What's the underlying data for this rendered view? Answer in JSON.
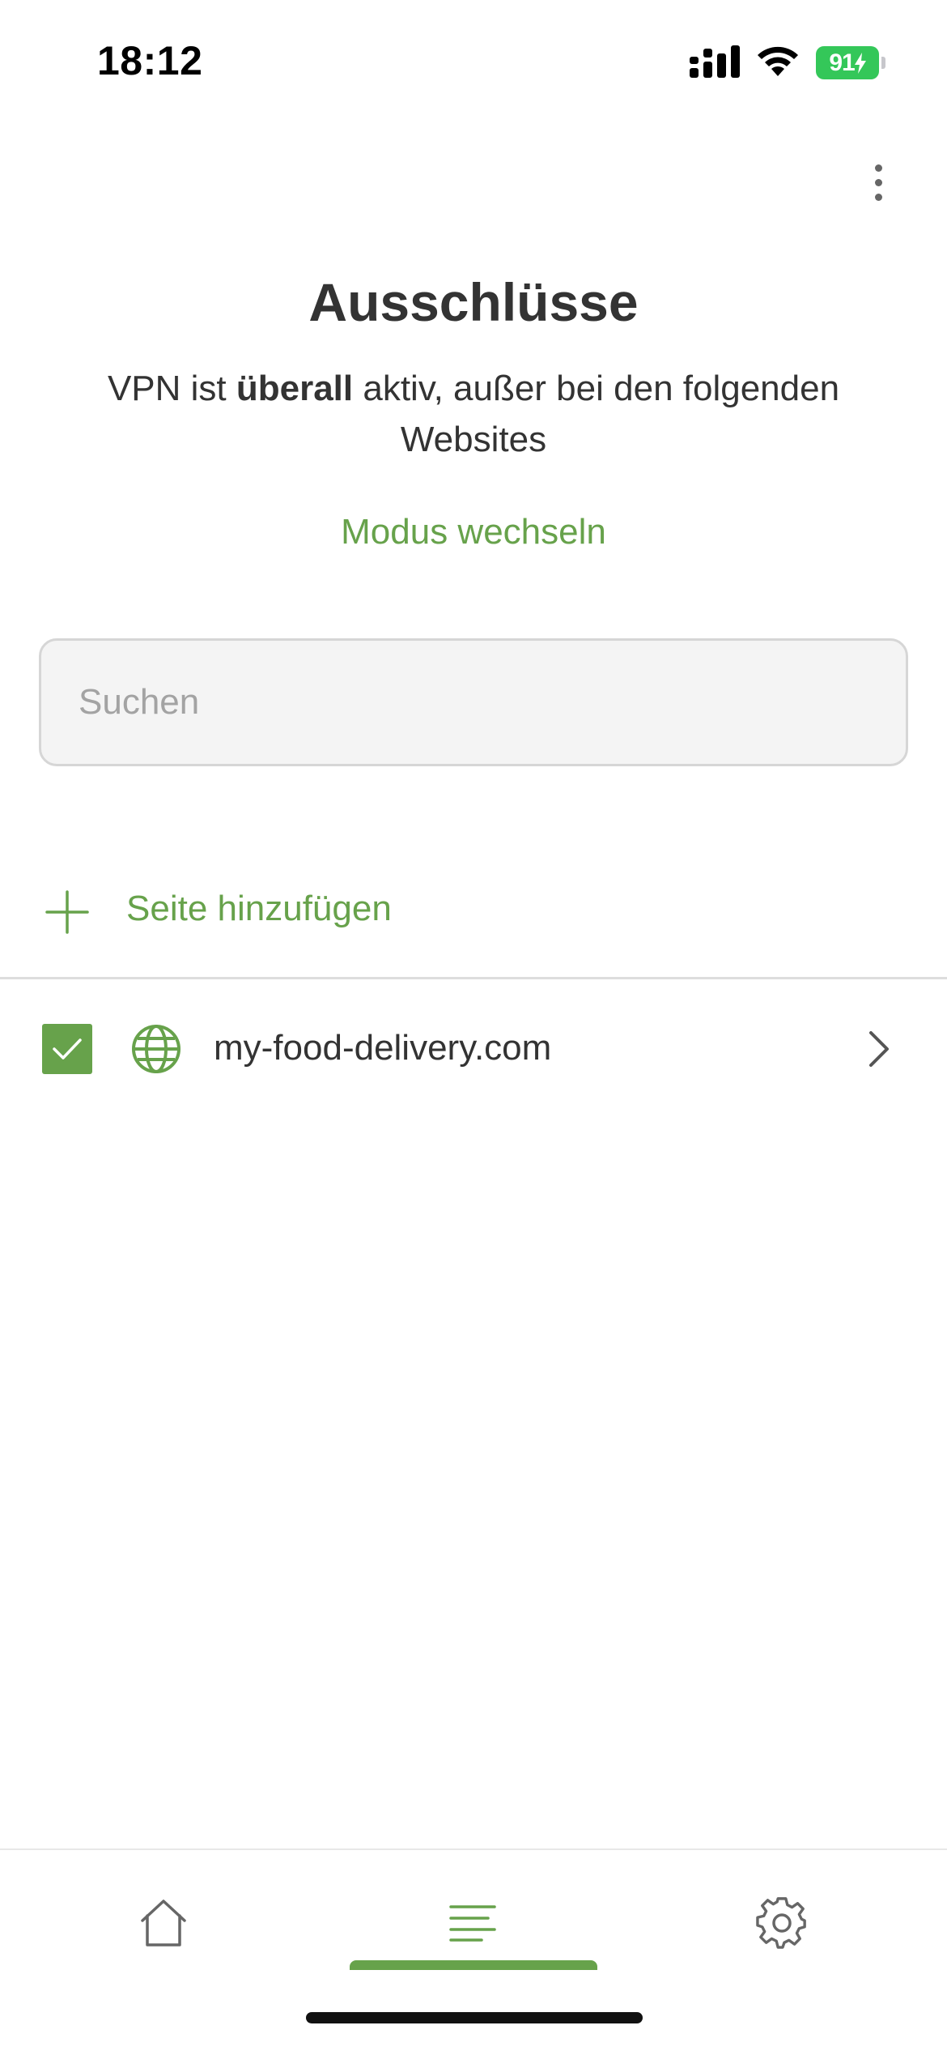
{
  "status_bar": {
    "time": "18:12",
    "battery_level": "91",
    "icons": [
      "signal-icon",
      "wifi-icon",
      "battery-charging-icon"
    ]
  },
  "header": {
    "menu_icon": "more-vertical-icon",
    "title": "Ausschlüsse",
    "subtitle_before": "VPN ist ",
    "subtitle_bold": "überall",
    "subtitle_after": " aktiv, außer bei den folgenden Websites",
    "switch_mode_label": "Modus wechseln"
  },
  "search": {
    "placeholder": "Suchen",
    "value": ""
  },
  "add_site": {
    "icon": "plus-icon",
    "label": "Seite hinzufügen"
  },
  "sites": [
    {
      "domain": "my-food-delivery.com",
      "checked": true,
      "icon": "globe-icon"
    }
  ],
  "tab_bar": {
    "tabs": [
      {
        "name": "home",
        "icon": "home-icon",
        "active": false
      },
      {
        "name": "exclusions",
        "icon": "list-icon",
        "active": true
      },
      {
        "name": "settings",
        "icon": "gear-icon",
        "active": false
      }
    ]
  },
  "colors": {
    "accent": "#67a24b",
    "text": "#333333",
    "battery": "#34c759",
    "search_bg": "#f4f4f4",
    "icon_gray": "#666666"
  }
}
